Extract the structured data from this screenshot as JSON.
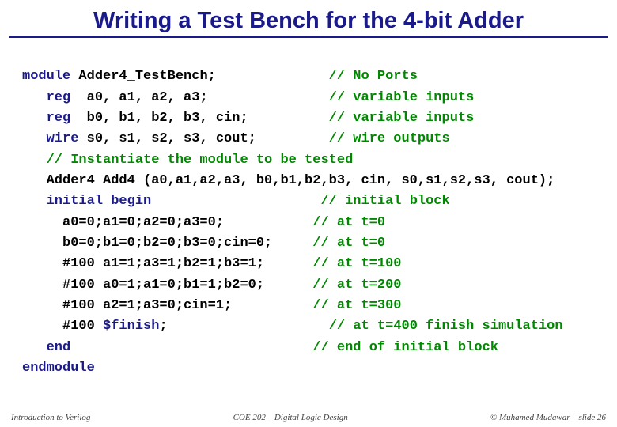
{
  "title": "Writing a Test Bench for the 4-bit Adder",
  "code": {
    "l1": {
      "kw": "module",
      "tx": " Adder4_TestBench;              ",
      "cm": "// No Ports"
    },
    "l2": {
      "kw": "   reg",
      "tx": "  a0, a1, a2, a3;               ",
      "cm": "// variable inputs"
    },
    "l3": {
      "kw": "   reg",
      "tx": "  b0, b1, b2, b3, cin;          ",
      "cm": "// variable inputs"
    },
    "l4": {
      "kw": "   wire",
      "tx": " s0, s1, s2, s3, cout;         ",
      "cm": "// wire outputs"
    },
    "l5": {
      "cm": "   // Instantiate the module to be tested"
    },
    "l6": {
      "tx": "   Adder4 Add4 (a0,a1,a2,a3, b0,b1,b2,b3, cin, s0,s1,s2,s3, cout);"
    },
    "l7": {
      "kw": "   initial begin",
      "tx": "                     ",
      "cm": "// initial block"
    },
    "l8": {
      "tx": "     a0=0;a1=0;a2=0;a3=0;           ",
      "cm": "// at t=0"
    },
    "l9": {
      "tx": "     b0=0;b1=0;b2=0;b3=0;cin=0;     ",
      "cm": "// at t=0"
    },
    "l10": {
      "tx": "     #100 a1=1;a3=1;b2=1;b3=1;      ",
      "cm": "// at t=100"
    },
    "l11": {
      "tx": "     #100 a0=1;a1=0;b1=1;b2=0;      ",
      "cm": "// at t=200"
    },
    "l12": {
      "tx": "     #100 a2=1;a3=0;cin=1;          ",
      "cm": "// at t=300"
    },
    "l13": {
      "tx": "     #100 ",
      "kw": "$finish",
      "tx2": ";                    ",
      "cm": "// at t=400 finish simulation"
    },
    "l14": {
      "kw": "   end",
      "tx": "                              ",
      "cm": "// end of initial block"
    },
    "l15": {
      "kw": "endmodule"
    }
  },
  "footer": {
    "left": "Introduction to Verilog",
    "center": "COE 202 – Digital Logic Design",
    "right": "© Muhamed Mudawar – slide 26"
  }
}
